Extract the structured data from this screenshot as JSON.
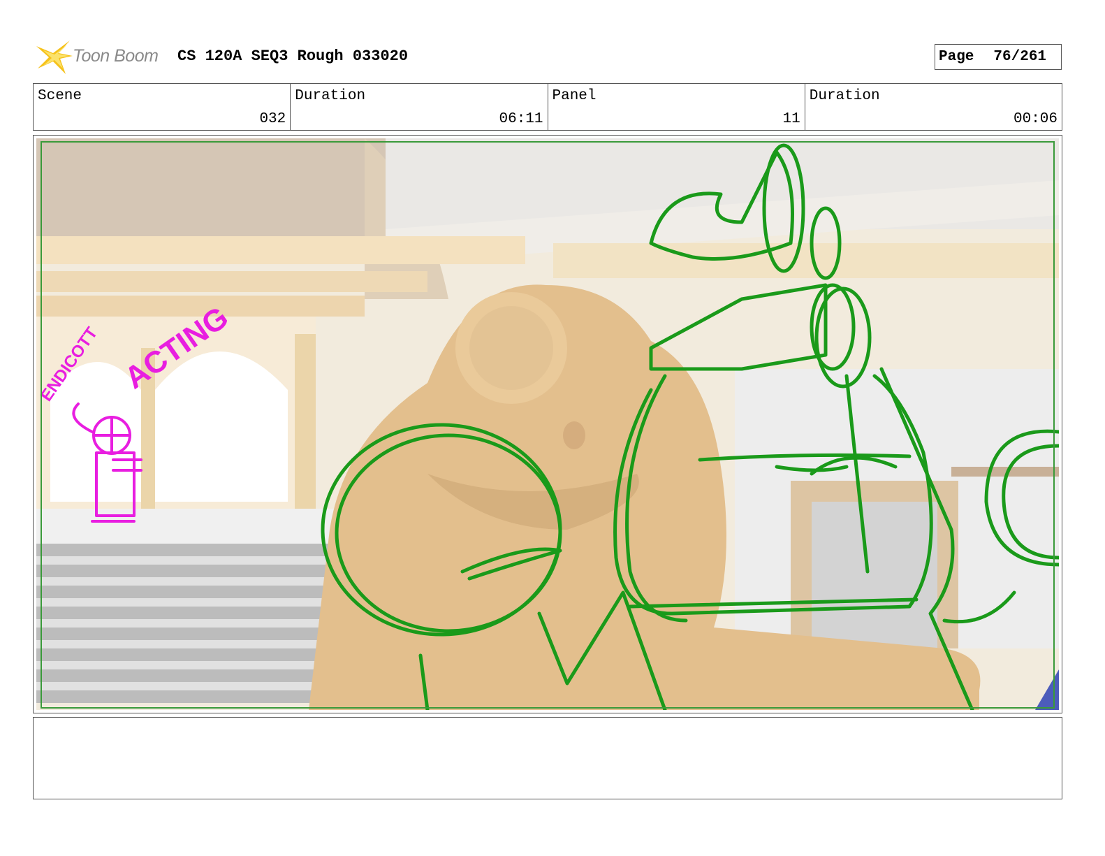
{
  "header": {
    "logo_text": "Toon Boom",
    "title": "CS 120A SEQ3 Rough 033020",
    "page_label": "Page",
    "page_number": "76/261"
  },
  "info": {
    "scene_label": "Scene",
    "scene_value": "032",
    "scene_duration_label": "Duration",
    "scene_duration_value": "06:11",
    "panel_label": "Panel",
    "panel_value": "11",
    "panel_duration_label": "Duration",
    "panel_duration_value": "00:06"
  },
  "panel": {
    "annotation_1": "ACTING",
    "annotation_2": "ENDICOTT",
    "colors": {
      "sketch_green": "#1a9a1a",
      "sketch_magenta": "#e81ee0",
      "frog_tan": "#dcae6e",
      "wall_cream": "#efe4cf",
      "safe_frame": "#3a9a3a"
    }
  },
  "notes": {
    "text": ""
  }
}
